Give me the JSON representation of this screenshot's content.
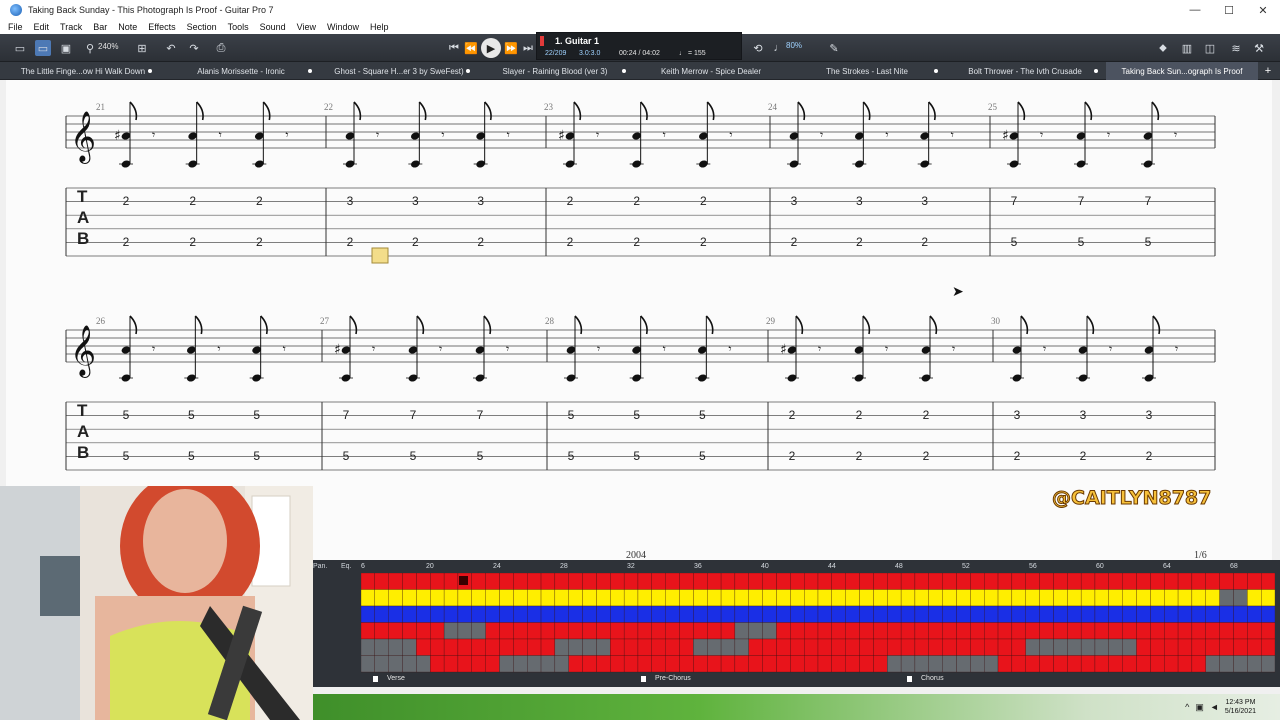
{
  "window": {
    "title": "Taking Back Sunday - This Photograph Is Proof - Guitar Pro 7",
    "minimize": "—",
    "maximize": "☐",
    "close": "✕"
  },
  "menu": [
    "File",
    "Edit",
    "Track",
    "Bar",
    "Note",
    "Effects",
    "Section",
    "Tools",
    "Sound",
    "View",
    "Window",
    "Help"
  ],
  "toolbar": {
    "zoom": "240%",
    "track_name": "1. Guitar 1",
    "bar_position": "22/209",
    "time_signature": "3.0:3.0",
    "time": "00:24 / 04:02",
    "tempo": "♩ = 155",
    "speed": "80%"
  },
  "tabs": [
    {
      "label": "The Little Finge...ow Hi Walk Down",
      "active": false
    },
    {
      "label": "Alanis Morissette - Ironic",
      "active": false
    },
    {
      "label": "Ghost - Square H...er 3 by SweFest)",
      "active": false
    },
    {
      "label": "Slayer - Raining Blood (ver 3)",
      "active": false
    },
    {
      "label": "Keith Merrow - Spice Dealer",
      "active": false
    },
    {
      "label": "The Strokes - Last Nite",
      "active": false
    },
    {
      "label": "Bolt Thrower - The Ivth Crusade",
      "active": false
    },
    {
      "label": "Taking Back Sun...ograph Is Proof",
      "active": true
    }
  ],
  "score": {
    "tab_letters": [
      "T",
      "A",
      "B"
    ],
    "systems": [
      {
        "bars": [
          {
            "number": "21",
            "top": "2",
            "bottom": "2",
            "sharp": true
          },
          {
            "number": "22",
            "top": "3",
            "bottom": "2",
            "sharp": false
          },
          {
            "number": "23",
            "top": "2",
            "bottom": "2",
            "sharp": true
          },
          {
            "number": "24",
            "top": "3",
            "bottom": "2",
            "sharp": false
          },
          {
            "number": "25",
            "top": "7",
            "bottom": "5",
            "sharp": true
          }
        ]
      },
      {
        "bars": [
          {
            "number": "26",
            "top": "5",
            "bottom": "5",
            "sharp": false
          },
          {
            "number": "27",
            "top": "7",
            "bottom": "5",
            "sharp": true
          },
          {
            "number": "28",
            "top": "5",
            "bottom": "5",
            "sharp": false
          },
          {
            "number": "29",
            "top": "2",
            "bottom": "2",
            "sharp": true
          },
          {
            "number": "30",
            "top": "3",
            "bottom": "2",
            "sharp": false
          }
        ]
      }
    ],
    "footer_left": "2004",
    "footer_right": "1/6"
  },
  "mixer": {
    "pan_label": "Pan.",
    "eq_label": "Eq.",
    "ruler": [
      "6",
      "20",
      "24",
      "28",
      "32",
      "36",
      "40",
      "44",
      "48",
      "52",
      "56",
      "60",
      "64",
      "68"
    ],
    "markers": [
      "Verse",
      "Pre-Chorus",
      "Chorus"
    ]
  },
  "watermark": "@CAITLYN8787",
  "clock": {
    "time": "12:43 PM",
    "date": "5/16/2021"
  },
  "colors": {
    "red": "#e8141b",
    "yellow": "#ffee00",
    "blue": "#1a2fe6",
    "gray": "#666b70"
  }
}
